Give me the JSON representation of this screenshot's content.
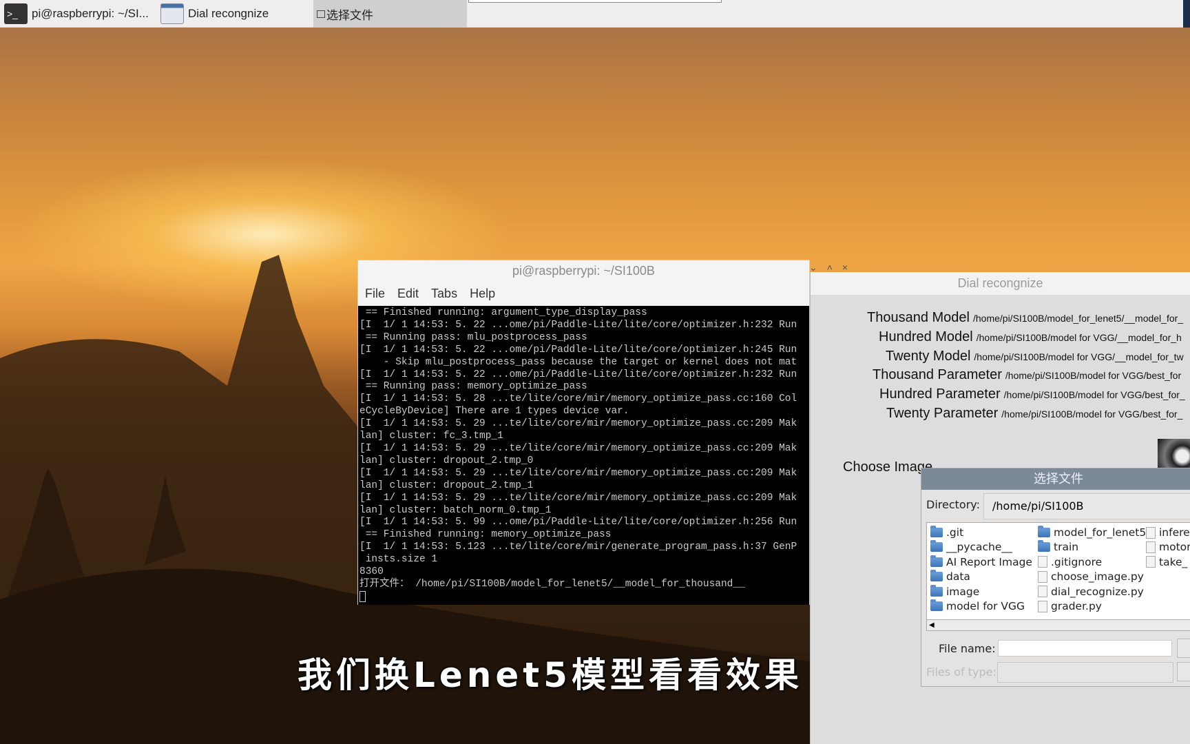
{
  "taskbar": {
    "items": [
      {
        "label": "pi@raspberrypi: ~/SI...",
        "icon": "terminal-icon"
      },
      {
        "label": "Dial recongnize",
        "icon": "window-icon"
      },
      {
        "label": "选择文件",
        "icon": "window-icon"
      }
    ]
  },
  "terminal": {
    "title": "pi@raspberrypi: ~/SI100B",
    "menu": [
      "File",
      "Edit",
      "Tabs",
      "Help"
    ],
    "lines": [
      " == Finished running: argument_type_display_pass",
      "[I  1/ 1 14:53: 5. 22 ...ome/pi/Paddle-Lite/lite/core/optimizer.h:232 Run",
      " == Running pass: mlu_postprocess_pass",
      "[I  1/ 1 14:53: 5. 22 ...ome/pi/Paddle-Lite/lite/core/optimizer.h:245 Run",
      "    - Skip mlu_postprocess_pass because the target or kernel does not mat",
      "[I  1/ 1 14:53: 5. 22 ...ome/pi/Paddle-Lite/lite/core/optimizer.h:232 Run",
      " == Running pass: memory_optimize_pass",
      "[I  1/ 1 14:53: 5. 28 ...te/lite/core/mir/memory_optimize_pass.cc:160 Col",
      "eCycleByDevice] There are 1 types device var.",
      "[I  1/ 1 14:53: 5. 29 ...te/lite/core/mir/memory_optimize_pass.cc:209 Mak",
      "lan] cluster: fc_3.tmp_1",
      "[I  1/ 1 14:53: 5. 29 ...te/lite/core/mir/memory_optimize_pass.cc:209 Mak",
      "lan] cluster: dropout_2.tmp_0",
      "[I  1/ 1 14:53: 5. 29 ...te/lite/core/mir/memory_optimize_pass.cc:209 Mak",
      "lan] cluster: dropout_2.tmp_1",
      "[I  1/ 1 14:53: 5. 29 ...te/lite/core/mir/memory_optimize_pass.cc:209 Mak",
      "lan] cluster: batch_norm_0.tmp_1",
      "[I  1/ 1 14:53: 5. 99 ...ome/pi/Paddle-Lite/lite/core/optimizer.h:256 Run",
      " == Finished running: memory_optimize_pass",
      "[I  1/ 1 14:53: 5.123 ...te/lite/core/mir/generate_program_pass.h:37 GenP",
      " insts.size 1",
      "8360",
      "打开文件： /home/pi/SI100B/model_for_lenet5/__model_for_thousand__"
    ]
  },
  "dial": {
    "title": "Dial recongnize",
    "rows": [
      {
        "label": "Thousand Model",
        "path": "/home/pi/SI100B/model_for_lenet5/__model_for_"
      },
      {
        "label": "Hundred Model",
        "path": "/home/pi/SI100B/model for VGG/__model_for_h"
      },
      {
        "label": "Twenty Model",
        "path": "/home/pi/SI100B/model for VGG/__model_for_tw"
      },
      {
        "label": "Thousand Parameter",
        "path": "/home/pi/SI100B/model for VGG/best_for"
      },
      {
        "label": "Hundred Parameter",
        "path": "/home/pi/SI100B/model for VGG/best_for_"
      },
      {
        "label": "Twenty Parameter",
        "path": "/home/pi/SI100B/model for VGG/best_for_"
      }
    ],
    "choose_image_label": "Choose Image"
  },
  "file_dialog": {
    "title": "选择文件",
    "directory_label": "Directory:",
    "directory": "/home/pi/SI100B",
    "items": [
      {
        "name": ".git",
        "type": "folder"
      },
      {
        "name": "__pycache__",
        "type": "folder"
      },
      {
        "name": "AI Report Image",
        "type": "folder"
      },
      {
        "name": "data",
        "type": "folder"
      },
      {
        "name": "image",
        "type": "folder"
      },
      {
        "name": "model for VGG",
        "type": "folder"
      },
      {
        "name": "model_for_lenet5",
        "type": "folder"
      },
      {
        "name": "train",
        "type": "folder"
      },
      {
        "name": ".gitignore",
        "type": "file"
      },
      {
        "name": "choose_image.py",
        "type": "file"
      },
      {
        "name": "dial_recognize.py",
        "type": "file"
      },
      {
        "name": "grader.py",
        "type": "file"
      },
      {
        "name": "infere",
        "type": "file"
      },
      {
        "name": "motor",
        "type": "file"
      },
      {
        "name": "take_",
        "type": "file"
      }
    ],
    "file_name_label": "File name:",
    "file_name": "",
    "files_of_type_label": "Files of type:"
  },
  "subtitle": "我们换Lenet5模型看看效果"
}
